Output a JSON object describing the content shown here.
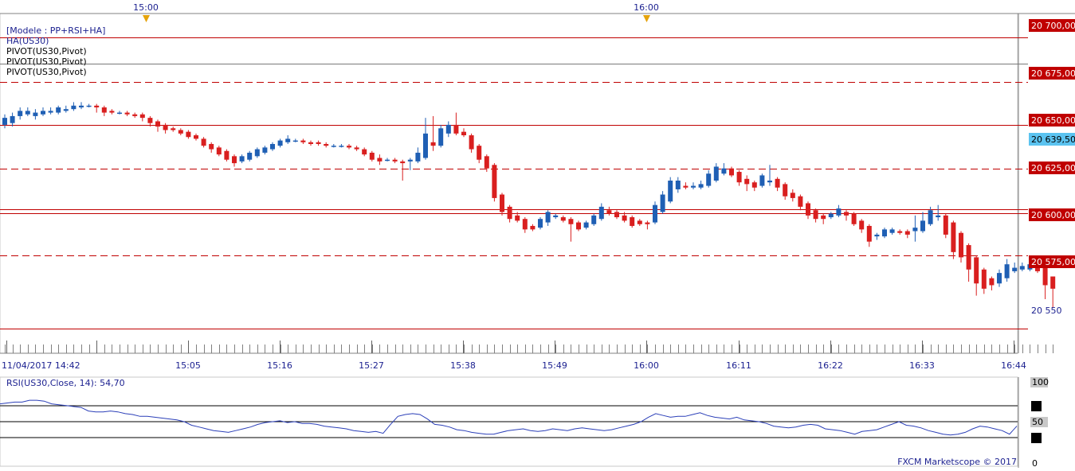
{
  "chart_data": [
    {
      "type": "candlestick",
      "instrument": "US30",
      "legend": [
        "[Modele : PP+RSI+HA]",
        "HA(US30)",
        "PIVOT(US30,Pivot)",
        "PIVOT(US30,Pivot)",
        "PIVOT(US30,Pivot)"
      ],
      "session_markers": [
        "15:00",
        "16:00"
      ],
      "x_labels": [
        "11/04/2017 14:42",
        "15:05",
        "15:16",
        "15:27",
        "15:38",
        "15:49",
        "16:00",
        "16:11",
        "16:22",
        "16:33",
        "16:44"
      ],
      "y_labels": [
        "20 700,00",
        "20 675,00",
        "20 650,00",
        "20 625,00",
        "20 600,00",
        "20 575,00",
        "20 550"
      ],
      "ylim": [
        20529,
        20707
      ],
      "last_price_label": "20 639,50",
      "last_price": 20639.5,
      "pivot_levels": [
        {
          "value": 20700,
          "style": "solid"
        },
        {
          "value": 20685,
          "style": "solid-thin"
        },
        {
          "value": 20674.5,
          "style": "dashed"
        },
        {
          "value": 20650,
          "style": "solid"
        },
        {
          "value": 20625,
          "style": "dashed"
        },
        {
          "value": 20601.5,
          "style": "solid"
        },
        {
          "value": 20599.5,
          "style": "solid"
        },
        {
          "value": 20575,
          "style": "dashed"
        },
        {
          "value": 20533,
          "style": "solid"
        }
      ],
      "candles": [
        [
          20650,
          20654,
          20656,
          20648
        ],
        [
          20651,
          20655,
          20657,
          20649
        ],
        [
          20655,
          20658,
          20660,
          20653
        ],
        [
          20656,
          20658,
          20660,
          20655
        ],
        [
          20655,
          20657,
          20659,
          20653
        ],
        [
          20656,
          20658,
          20660,
          20655
        ],
        [
          20657,
          20658,
          20660,
          20656
        ],
        [
          20657,
          20660,
          20661,
          20656
        ],
        [
          20658,
          20659,
          20661,
          20657
        ],
        [
          20659,
          20661,
          20663,
          20658
        ],
        [
          20660,
          20661,
          20663,
          20659
        ],
        [
          20661,
          20661,
          20662,
          20660
        ],
        [
          20661,
          20660,
          20662,
          20657
        ],
        [
          20660,
          20657,
          20661,
          20655
        ],
        [
          20658,
          20657,
          20659,
          20656
        ],
        [
          20657,
          20657,
          20658,
          20656
        ],
        [
          20657,
          20656,
          20658,
          20655
        ],
        [
          20656,
          20655,
          20657,
          20654
        ],
        [
          20656,
          20654,
          20657,
          20652
        ],
        [
          20654,
          20651,
          20655,
          20649
        ],
        [
          20652,
          20649,
          20653,
          20646
        ],
        [
          20650,
          20647,
          20651,
          20645
        ],
        [
          20648,
          20647,
          20649,
          20646
        ],
        [
          20647,
          20645,
          20648,
          20644
        ],
        [
          20646,
          20643,
          20647,
          20642
        ],
        [
          20644,
          20642,
          20645,
          20641
        ],
        [
          20642,
          20638,
          20643,
          20637
        ],
        [
          20639,
          20636,
          20640,
          20634
        ],
        [
          20637,
          20633,
          20638,
          20632
        ],
        [
          20635,
          20630,
          20636,
          20629
        ],
        [
          20632,
          20628,
          20633,
          20626
        ],
        [
          20629,
          20632,
          20633,
          20628
        ],
        [
          20630,
          20634,
          20635,
          20629
        ],
        [
          20632,
          20636,
          20637,
          20631
        ],
        [
          20634,
          20637,
          20638,
          20633
        ],
        [
          20636,
          20639,
          20640,
          20635
        ],
        [
          20638,
          20641,
          20642,
          20637
        ],
        [
          20640,
          20642,
          20644,
          20639
        ],
        [
          20641,
          20641,
          20642,
          20640
        ],
        [
          20641,
          20640,
          20642,
          20639
        ],
        [
          20640,
          20639,
          20641,
          20638
        ],
        [
          20640,
          20639,
          20641,
          20638
        ],
        [
          20639,
          20638,
          20640,
          20637
        ],
        [
          20638,
          20638,
          20639,
          20637
        ],
        [
          20638,
          20638,
          20639,
          20637
        ],
        [
          20638,
          20637,
          20639,
          20636
        ],
        [
          20637,
          20636,
          20638,
          20635
        ],
        [
          20636,
          20633,
          20637,
          20632
        ],
        [
          20634,
          20630,
          20635,
          20629
        ],
        [
          20631,
          20629,
          20633,
          20627
        ],
        [
          20630,
          20630,
          20631,
          20629
        ],
        [
          20630,
          20629,
          20631,
          20628
        ],
        [
          20629,
          20628,
          20630,
          20618
        ],
        [
          20629,
          20630,
          20631,
          20624
        ],
        [
          20629,
          20634,
          20637,
          20628
        ],
        [
          20631,
          20645,
          20654,
          20630
        ],
        [
          20640,
          20638,
          20655,
          20635
        ],
        [
          20638,
          20648,
          20650,
          20637
        ],
        [
          20645,
          20650,
          20652,
          20643
        ],
        [
          20650,
          20645,
          20657,
          20644
        ],
        [
          20646,
          20644,
          20648,
          20643
        ],
        [
          20644,
          20636,
          20645,
          20634
        ],
        [
          20638,
          20630,
          20639,
          20628
        ],
        [
          20632,
          20625,
          20633,
          20623
        ],
        [
          20627,
          20608,
          20628,
          20606
        ],
        [
          20610,
          20600,
          20611,
          20598
        ],
        [
          20603,
          20596,
          20604,
          20594
        ],
        [
          20598,
          20595,
          20600,
          20594
        ],
        [
          20596,
          20590,
          20597,
          20588
        ],
        [
          20592,
          20590,
          20593,
          20589
        ],
        [
          20591,
          20596,
          20597,
          20590
        ],
        [
          20594,
          20600,
          20601,
          20592
        ],
        [
          20597,
          20598,
          20599,
          20596
        ],
        [
          20597,
          20595,
          20598,
          20594
        ],
        [
          20596,
          20593,
          20597,
          20583
        ],
        [
          20594,
          20590,
          20595,
          20589
        ],
        [
          20591,
          20594,
          20595,
          20590
        ],
        [
          20593,
          20598,
          20599,
          20592
        ],
        [
          20596,
          20603,
          20605,
          20595
        ],
        [
          20601,
          20599,
          20603,
          20598
        ],
        [
          20600,
          20597,
          20601,
          20596
        ],
        [
          20598,
          20595,
          20600,
          20594
        ],
        [
          20597,
          20592,
          20598,
          20591
        ],
        [
          20595,
          20593,
          20596,
          20592
        ],
        [
          20594,
          20593,
          20595,
          20590
        ],
        [
          20594,
          20604,
          20606,
          20593
        ],
        [
          20600,
          20610,
          20612,
          20599
        ],
        [
          20606,
          20618,
          20620,
          20605
        ],
        [
          20613,
          20618,
          20620,
          20611
        ],
        [
          20615,
          20614,
          20617,
          20613
        ],
        [
          20614,
          20615,
          20617,
          20613
        ],
        [
          20614,
          20616,
          20618,
          20613
        ],
        [
          20615,
          20622,
          20624,
          20614
        ],
        [
          20618,
          20626,
          20628,
          20617
        ],
        [
          20622,
          20625,
          20628,
          20621
        ],
        [
          20625,
          20621,
          20626,
          20620
        ],
        [
          20623,
          20617,
          20624,
          20615
        ],
        [
          20619,
          20616,
          20621,
          20612
        ],
        [
          20617,
          20614,
          20618,
          20612
        ],
        [
          20615,
          20621,
          20622,
          20614
        ],
        [
          20617,
          20618,
          20627,
          20615
        ],
        [
          20619,
          20614,
          20620,
          20612
        ],
        [
          20616,
          20609,
          20617,
          20607
        ],
        [
          20611,
          20608,
          20613,
          20606
        ],
        [
          20609,
          20603,
          20610,
          20601
        ],
        [
          20605,
          20598,
          20606,
          20596
        ],
        [
          20601,
          20596,
          20602,
          20594
        ],
        [
          20598,
          20596,
          20599,
          20593
        ],
        [
          20597,
          20599,
          20600,
          20596
        ],
        [
          20598,
          20602,
          20604,
          20597
        ],
        [
          20600,
          20598,
          20601,
          20595
        ],
        [
          20599,
          20593,
          20600,
          20592
        ],
        [
          20595,
          20590,
          20596,
          20588
        ],
        [
          20592,
          20583,
          20593,
          20580
        ],
        [
          20586,
          20587,
          20588,
          20584
        ],
        [
          20586,
          20590,
          20591,
          20585
        ],
        [
          20588,
          20590,
          20591,
          20587
        ],
        [
          20589,
          20588,
          20590,
          20587
        ],
        [
          20589,
          20587,
          20590,
          20585
        ],
        [
          20589,
          20591,
          20598,
          20583
        ],
        [
          20589,
          20595,
          20600,
          20588
        ],
        [
          20593,
          20601,
          20603,
          20592
        ],
        [
          20597,
          20598,
          20604,
          20595
        ],
        [
          20598,
          20587,
          20599,
          20585
        ],
        [
          20594,
          20577,
          20595,
          20573
        ],
        [
          20588,
          20574,
          20589,
          20571
        ],
        [
          20581,
          20567,
          20582,
          20560
        ],
        [
          20574,
          20559,
          20575,
          20552
        ],
        [
          20567,
          20556,
          20568,
          20553
        ],
        [
          20562,
          20558,
          20563,
          20555
        ],
        [
          20559,
          20565,
          20567,
          20557
        ],
        [
          20562,
          20570,
          20573,
          20560
        ],
        [
          20566,
          20568,
          20571,
          20565
        ],
        [
          20567,
          20569,
          20571,
          20566
        ],
        [
          20567,
          20570,
          20571,
          20566
        ],
        [
          20569,
          20566,
          20570,
          20565
        ],
        [
          20568,
          20558,
          20568,
          20550
        ],
        [
          20563,
          20556,
          20563,
          20545
        ]
      ]
    },
    {
      "type": "line",
      "title": "RSI(US30,Close, 14): 54,70",
      "y_labels": [
        "100",
        "50",
        "0"
      ],
      "ylim": [
        0,
        100
      ],
      "bands": [
        30,
        40,
        50,
        70
      ],
      "source": "FXCM Marketscope © 2017",
      "values": [
        70,
        71,
        72,
        72,
        74,
        74,
        73,
        70,
        69,
        68,
        67,
        66,
        62,
        61,
        61,
        62,
        61,
        59,
        58,
        56,
        56,
        55,
        54,
        53,
        52,
        50,
        46,
        44,
        42,
        40,
        39,
        38,
        40,
        42,
        44,
        47,
        49,
        50,
        51,
        49,
        50,
        48,
        48,
        47,
        45,
        44,
        43,
        42,
        40,
        39,
        38,
        39,
        37,
        47,
        56,
        58,
        59,
        58,
        53,
        47,
        46,
        44,
        41,
        40,
        38,
        37,
        36,
        36,
        38,
        40,
        41,
        42,
        40,
        39,
        40,
        42,
        41,
        40,
        42,
        43,
        42,
        41,
        40,
        41,
        43,
        45,
        47,
        50,
        55,
        59,
        57,
        55,
        56,
        56,
        58,
        60,
        57,
        55,
        54,
        53,
        55,
        52,
        51,
        50,
        48,
        45,
        44,
        43,
        44,
        46,
        47,
        46,
        42,
        41,
        40,
        38,
        36,
        39,
        40,
        41,
        44,
        47,
        50,
        46,
        45,
        43,
        40,
        38,
        36,
        35,
        36,
        38,
        42,
        45,
        44,
        42,
        40,
        36,
        45
      ]
    }
  ],
  "colors": {
    "up": "#1f5fb4",
    "down": "#d91f1f",
    "pivot": "#c00000",
    "rsi_line": "#2b3fb8",
    "text": "#1a1f8f",
    "price_box_bg": "#5bc3f0"
  }
}
